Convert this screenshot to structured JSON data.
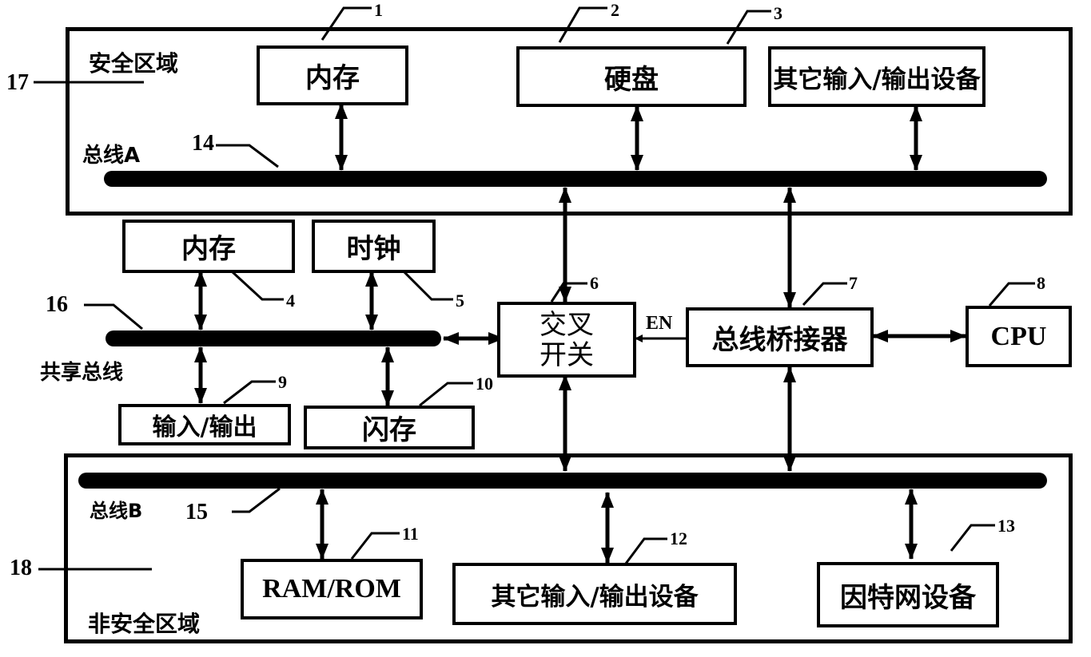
{
  "zones": {
    "secure": {
      "label": "安全区域",
      "ref": "17"
    },
    "insecure": {
      "label": "非安全区域",
      "ref": "18"
    }
  },
  "buses": {
    "bus_a": {
      "label": "总线A",
      "ref": "14"
    },
    "bus_b": {
      "label": "总线B",
      "ref": "15"
    },
    "shared": {
      "label": "共享总线",
      "ref": "16"
    }
  },
  "components": {
    "memory_a": {
      "label": "内存",
      "ref": "1"
    },
    "hdd": {
      "label": "硬盘",
      "ref": "2"
    },
    "io_a": {
      "label": "其它输入/输出设备",
      "ref": "3"
    },
    "memory_shared": {
      "label": "内存",
      "ref": "4"
    },
    "clock": {
      "label": "时钟",
      "ref": "5"
    },
    "cross_switch": {
      "label_line1": "交叉",
      "label_line2": "开关",
      "ref": "6"
    },
    "bus_bridge": {
      "label": "总线桥接器",
      "ref": "7"
    },
    "cpu": {
      "label": "CPU",
      "ref": "8"
    },
    "io_shared": {
      "label": "输入/输出",
      "ref": "9"
    },
    "flash": {
      "label": "闪存",
      "ref": "10"
    },
    "ram_rom": {
      "label": "RAM/ROM",
      "ref": "11"
    },
    "io_b": {
      "label": "其它输入/输出设备",
      "ref": "12"
    },
    "internet": {
      "label": "因特网设备",
      "ref": "13"
    }
  },
  "signals": {
    "enable": "EN"
  }
}
